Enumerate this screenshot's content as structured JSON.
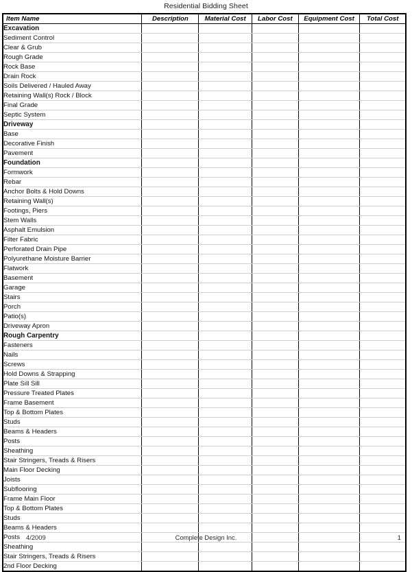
{
  "document": {
    "title": "Residential Bidding Sheet"
  },
  "table": {
    "columns": [
      {
        "key": "item",
        "label": "Item Name"
      },
      {
        "key": "description",
        "label": "Description"
      },
      {
        "key": "material",
        "label": "Material Cost"
      },
      {
        "key": "labor",
        "label": "Labor Cost"
      },
      {
        "key": "equipment",
        "label": "Equipment Cost"
      },
      {
        "key": "total",
        "label": "Total Cost"
      }
    ],
    "rows": [
      {
        "name": "Excavation",
        "level": 0,
        "section": true
      },
      {
        "name": "Sediment Control",
        "level": 1,
        "section": false
      },
      {
        "name": "Clear & Grub",
        "level": 1,
        "section": false
      },
      {
        "name": "Rough Grade",
        "level": 1,
        "section": false
      },
      {
        "name": "Rock Base",
        "level": 2,
        "section": false
      },
      {
        "name": "Drain Rock",
        "level": 2,
        "section": false
      },
      {
        "name": "Soils Delivered / Hauled Away",
        "level": 1,
        "section": false
      },
      {
        "name": "Retaining Wall(s) Rock / Block",
        "level": 1,
        "section": false
      },
      {
        "name": "Final Grade",
        "level": 1,
        "section": false
      },
      {
        "name": "Septic System",
        "level": 1,
        "section": false
      },
      {
        "name": "Driveway",
        "level": 0,
        "section": true
      },
      {
        "name": "Base",
        "level": 1,
        "section": false
      },
      {
        "name": "Decorative Finish",
        "level": 1,
        "section": false
      },
      {
        "name": "Pavement",
        "level": 1,
        "section": false
      },
      {
        "name": "Foundation",
        "level": 0,
        "section": true
      },
      {
        "name": "Formwork",
        "level": 1,
        "section": false
      },
      {
        "name": "Rebar",
        "level": 1,
        "section": false
      },
      {
        "name": "Anchor Bolts & Hold Downs",
        "level": 1,
        "section": false
      },
      {
        "name": "Retaining Wall(s)",
        "level": 1,
        "section": false
      },
      {
        "name": "Footings, Piers",
        "level": 1,
        "section": false
      },
      {
        "name": "Stem Walls",
        "level": 1,
        "section": false
      },
      {
        "name": "Asphalt Emulsion",
        "level": 1,
        "section": false
      },
      {
        "name": "Filter Fabric",
        "level": 1,
        "section": false
      },
      {
        "name": "Perforated Drain Pipe",
        "level": 1,
        "section": false
      },
      {
        "name": "Polyurethane Moisture Barrier",
        "level": 1,
        "section": false
      },
      {
        "name": "Flatwork",
        "level": 1,
        "section": false
      },
      {
        "name": "Basement",
        "level": 2,
        "section": false
      },
      {
        "name": "Garage",
        "level": 2,
        "section": false
      },
      {
        "name": "Stairs",
        "level": 2,
        "section": false
      },
      {
        "name": "Porch",
        "level": 2,
        "section": false
      },
      {
        "name": "Patio(s)",
        "level": 2,
        "section": false
      },
      {
        "name": "Driveway Apron",
        "level": 2,
        "section": false
      },
      {
        "name": "Rough Carpentry",
        "level": 0,
        "section": true
      },
      {
        "name": "Fasteners",
        "level": 1,
        "section": false
      },
      {
        "name": "Nails",
        "level": 2,
        "section": false
      },
      {
        "name": "Screws",
        "level": 2,
        "section": false
      },
      {
        "name": "Hold Downs & Strapping",
        "level": 1,
        "section": false
      },
      {
        "name": "Plate Sill Sill",
        "level": 1,
        "section": false
      },
      {
        "name": "Pressure Treated Plates",
        "level": 1,
        "section": false
      },
      {
        "name": "Frame Basement",
        "level": 1,
        "section": false
      },
      {
        "name": "Top & Bottom Plates",
        "level": 2,
        "section": false
      },
      {
        "name": "Studs",
        "level": 2,
        "section": false
      },
      {
        "name": "Beams & Headers",
        "level": 2,
        "section": false
      },
      {
        "name": "Posts",
        "level": 2,
        "section": false
      },
      {
        "name": "Sheathing",
        "level": 2,
        "section": false
      },
      {
        "name": "Stair Stringers, Treads & Risers",
        "level": 2,
        "section": false
      },
      {
        "name": "Main Floor Decking",
        "level": 1,
        "section": false
      },
      {
        "name": "Joists",
        "level": 2,
        "section": false
      },
      {
        "name": "Subflooring",
        "level": 2,
        "section": false
      },
      {
        "name": "Frame Main Floor",
        "level": 1,
        "section": false
      },
      {
        "name": "Top & Bottom Plates",
        "level": 2,
        "section": false
      },
      {
        "name": "Studs",
        "level": 2,
        "section": false
      },
      {
        "name": "Beams & Headers",
        "level": 2,
        "section": false
      },
      {
        "name": "Posts",
        "level": 2,
        "section": false
      },
      {
        "name": "Sheathing",
        "level": 2,
        "section": false
      },
      {
        "name": "Stair Stringers, Treads & Risers",
        "level": 2,
        "section": false
      },
      {
        "name": "2nd Floor Decking",
        "level": 1,
        "section": false
      }
    ]
  },
  "footer": {
    "date": "4/2009",
    "company": "Complete Design Inc.",
    "page_number": "1"
  }
}
